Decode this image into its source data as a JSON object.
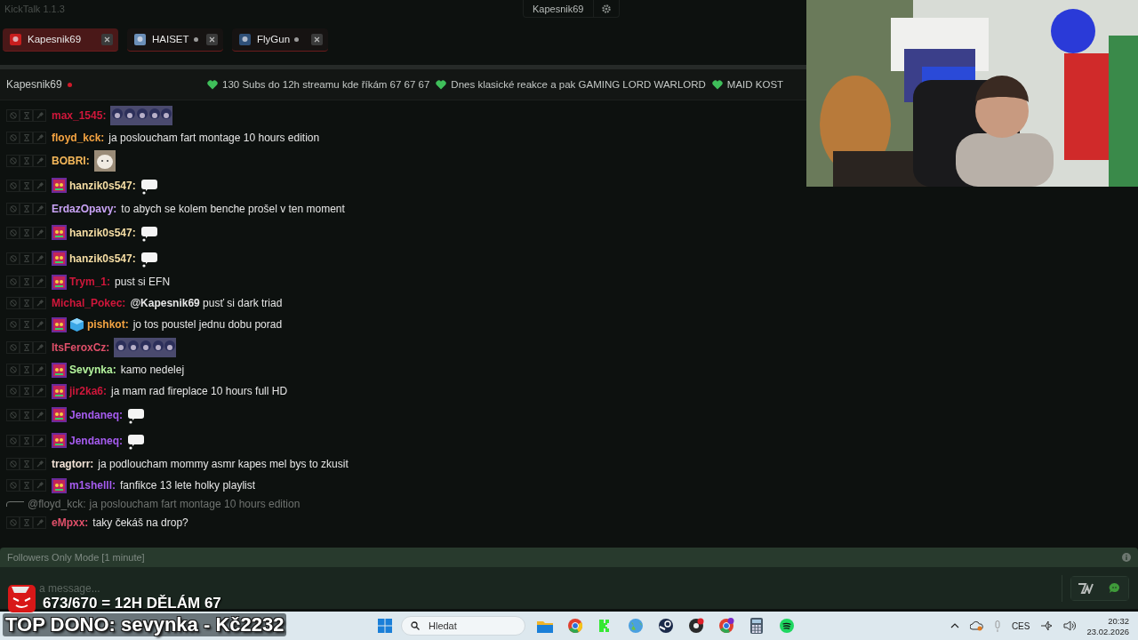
{
  "app": {
    "title": "KickTalk 1.1.3",
    "channel_button": "Kapesnik69"
  },
  "tabs": [
    {
      "label": "Kapesnik69",
      "selected": true,
      "offline_dot": false
    },
    {
      "label": "HAISET",
      "selected": false,
      "offline_dot": true
    },
    {
      "label": "FlyGun",
      "selected": false,
      "offline_dot": true
    }
  ],
  "chat_header": {
    "channel": "Kapesnik69",
    "live": true,
    "pinned": [
      "130 Subs do 12h streamu kde říkám 67 67 67",
      "Dnes klasické reakce a pak GAMING LORD WARLORD",
      "MAID KOST"
    ]
  },
  "messages": [
    {
      "kind": "strip",
      "user": "max_1545:",
      "color": "#d0173b",
      "sub_badge": false,
      "gift_badge": false
    },
    {
      "kind": "text",
      "user": "floyd_kck:",
      "color": "#f5a442",
      "sub_badge": false,
      "gift_badge": false,
      "text": "ja posloucham fart montage 10 hours edition"
    },
    {
      "kind": "dog",
      "user": "BOBRI:",
      "color": "#f5b85a",
      "sub_badge": false,
      "gift_badge": false
    },
    {
      "kind": "bubble",
      "user": "hanzik0s547:",
      "color": "#f7dfa5",
      "sub_badge": true,
      "gift_badge": false
    },
    {
      "kind": "text",
      "user": "ErdazOpavy:",
      "color": "#c9a3f5",
      "sub_badge": false,
      "gift_badge": false,
      "text": "to abych se kolem benche prošel v ten moment"
    },
    {
      "kind": "bubble",
      "user": "hanzik0s547:",
      "color": "#f7dfa5",
      "sub_badge": true,
      "gift_badge": false
    },
    {
      "kind": "bubble",
      "user": "hanzik0s547:",
      "color": "#f7dfa5",
      "sub_badge": true,
      "gift_badge": false
    },
    {
      "kind": "text",
      "user": "Trym_1:",
      "color": "#d0173b",
      "sub_badge": true,
      "gift_badge": false,
      "text": "pust si EFN"
    },
    {
      "kind": "text",
      "user": "Michal_Pokec:",
      "color": "#d0173b",
      "sub_badge": false,
      "gift_badge": false,
      "text": "**@Kapesnik69** pusť si dark triad"
    },
    {
      "kind": "text",
      "user": "pishkot:",
      "color": "#f5a442",
      "sub_badge": true,
      "gift_badge": true,
      "text": "jo tos poustel jednu dobu porad"
    },
    {
      "kind": "strip",
      "user": "ItsFeroxCz:",
      "color": "#e0506a",
      "sub_badge": false,
      "gift_badge": false
    },
    {
      "kind": "text",
      "user": "Sevynka:",
      "color": "#b5f59e",
      "sub_badge": true,
      "gift_badge": false,
      "text": "kamo nedelej"
    },
    {
      "kind": "text",
      "user": "jir2ka6:",
      "color": "#d0173b",
      "sub_badge": true,
      "gift_badge": false,
      "text": "ja mam rad fireplace 10 hours full HD"
    },
    {
      "kind": "bubble",
      "user": "Jendaneq:",
      "color": "#a65cf0",
      "sub_badge": true,
      "gift_badge": false
    },
    {
      "kind": "bubble",
      "user": "Jendaneq:",
      "color": "#a65cf0",
      "sub_badge": true,
      "gift_badge": false
    },
    {
      "kind": "text",
      "user": "tragtorr:",
      "color": "#f2e2d6",
      "sub_badge": false,
      "gift_badge": false,
      "text": "ja podloucham mommy asmr kapes mel bys to zkusit"
    },
    {
      "kind": "text",
      "user": "m1shelll:",
      "color": "#a65cf0",
      "sub_badge": true,
      "gift_badge": false,
      "text": "fanfikce 13 lete holky playlist"
    },
    {
      "kind": "text",
      "user": "eMpxx:",
      "color": "#e0506a",
      "sub_badge": false,
      "gift_badge": false,
      "text": "taky čekáš na drop?",
      "reply": {
        "user": "@floyd_kck:",
        "text": "ja posloucham fart montage 10 hours edition"
      }
    }
  ],
  "followers_mode": "Followers Only Mode [1 minute]",
  "input": {
    "placeholder": "a message..."
  },
  "stream_overlay": {
    "goal": "673/670 = 12H DĚLÁM 67",
    "top_donation": "TOP DONO: sevynka - Kč2232"
  },
  "taskbar": {
    "search_placeholder": "Hledat",
    "language": "CES",
    "time": "20:32",
    "date": "23.02.2026"
  }
}
